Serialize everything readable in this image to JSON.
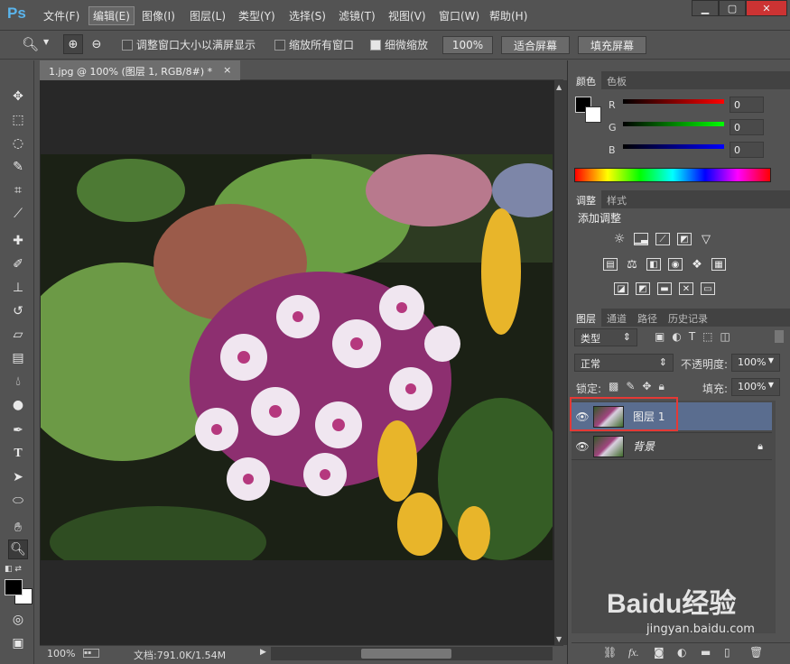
{
  "app": {
    "logo": "Ps"
  },
  "menu": [
    "文件(F)",
    "编辑(E)",
    "图像(I)",
    "图层(L)",
    "类型(Y)",
    "选择(S)",
    "滤镜(T)",
    "视图(V)",
    "窗口(W)",
    "帮助(H)"
  ],
  "options": {
    "resize_windows": "调整窗口大小以满屏显示",
    "zoom_all": "缩放所有窗口",
    "scrubby_zoom": "细微缩放",
    "btn_100": "100%",
    "btn_fit": "适合屏幕",
    "btn_fill": "填充屏幕"
  },
  "document": {
    "tab_title": "1.jpg @ 100% (图层 1, RGB/8#) *",
    "close": "×",
    "zoom": "100%",
    "doc_info": "文档:791.0K/1.54M"
  },
  "color_panel": {
    "tabs": [
      "颜色",
      "色板"
    ],
    "r_label": "R",
    "g_label": "G",
    "b_label": "B",
    "r": "0",
    "g": "0",
    "b": "0"
  },
  "adjust_panel": {
    "tabs": [
      "调整",
      "样式"
    ],
    "title": "添加调整"
  },
  "layers_panel": {
    "tabs": [
      "图层",
      "通道",
      "路径",
      "历史记录"
    ],
    "filter": "类型",
    "blend": "正常",
    "opacity_label": "不透明度:",
    "opacity": "100%",
    "lock_label": "锁定:",
    "fill_label": "填充:",
    "fill": "100%",
    "layers": [
      {
        "name": "图层 1",
        "selected": true
      },
      {
        "name": "背景",
        "selected": false
      }
    ]
  },
  "watermark": {
    "brand": "Baidu经验",
    "url": "jingyan.baidu.com"
  },
  "colors": {
    "accent": "#5ab4ec",
    "layer_selected": "#5a6d8f",
    "highlight_box": "#e53935"
  }
}
